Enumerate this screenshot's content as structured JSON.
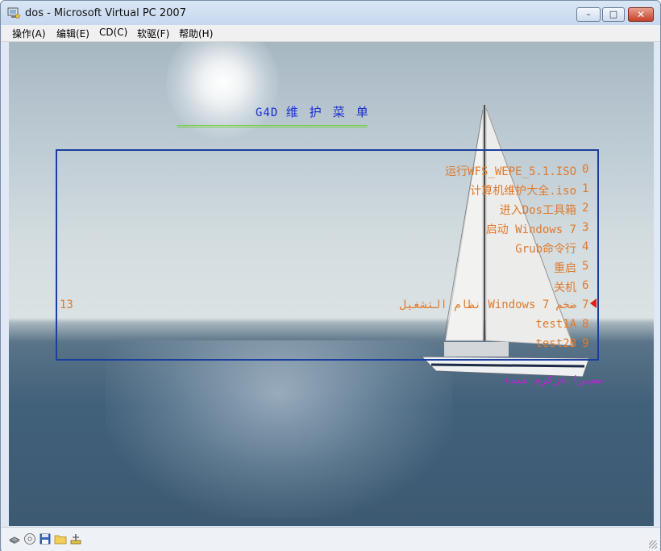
{
  "window": {
    "title": "dos - Microsoft Virtual PC 2007",
    "buttons": {
      "minimize": "–",
      "maximize": "□",
      "close": "✕"
    }
  },
  "menubar": {
    "items": [
      "操作(A)",
      "编辑(E)",
      "CD(C)",
      "软驱(F)",
      "帮助(H)"
    ]
  },
  "boot_menu": {
    "title_prefix": "G4D",
    "title_cjk": "维护菜单",
    "separator": "==========================================",
    "entries": [
      {
        "label": "运行WFS_WEPE_5.1.ISO",
        "num": "0"
      },
      {
        "label": "计算机维护大全.iso",
        "num": "1"
      },
      {
        "label": "进入Dos工具箱",
        "num": "2"
      },
      {
        "label": "启动 Windows 7",
        "num": "3"
      },
      {
        "label": "Grub命令行",
        "num": "4"
      },
      {
        "label": "重启",
        "num": "5"
      },
      {
        "label": "关机",
        "num": "6"
      },
      {
        "label": "نظام التشغيل Windows 7 ضخم",
        "num": "7"
      },
      {
        "label": "test1A",
        "num": "8"
      },
      {
        "label": "test2B",
        "num": "9"
      }
    ],
    "selected_index": 7,
    "countdown": "13",
    "footer": "مضبرا ةزكرم مبدء"
  },
  "colors": {
    "entry_text": "#e07a2c",
    "title_text": "#1a2fd0",
    "separator": "#6ccf3a",
    "frame": "#1a3fa0",
    "footer": "#c81ce0",
    "selector": "#e02010"
  },
  "statusbar": {
    "icons": [
      "hard-disk-icon",
      "cd-drive-icon",
      "floppy-icon",
      "shared-folder-icon",
      "network-adapter-icon"
    ]
  }
}
